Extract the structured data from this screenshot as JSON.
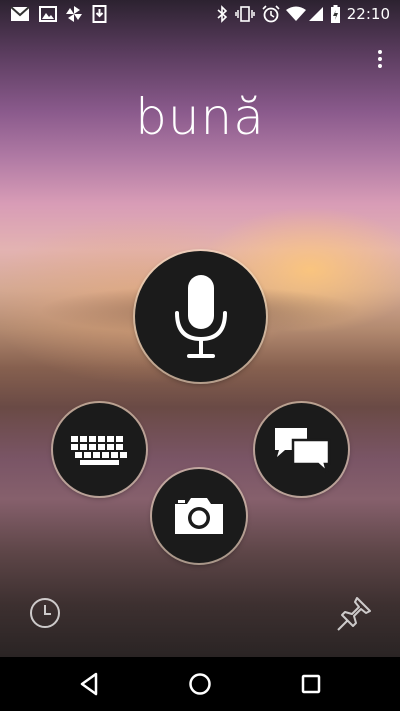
{
  "status_bar": {
    "time": "22:10",
    "left_icons": [
      "gmail-icon",
      "gallery-icon",
      "pinwheel-icon",
      "download-icon"
    ],
    "right_icons": [
      "bluetooth-icon",
      "vibrate-icon",
      "alarm-icon",
      "wifi-icon",
      "signal-icon",
      "battery-icon"
    ]
  },
  "app": {
    "greeting": "bună"
  },
  "actions": [
    {
      "name": "microphone",
      "icon": "microphone-icon"
    },
    {
      "name": "keyboard",
      "icon": "keyboard-icon"
    },
    {
      "name": "conversation",
      "icon": "chat-bubbles-icon"
    },
    {
      "name": "camera",
      "icon": "camera-icon"
    }
  ],
  "bottom": {
    "left_icon": "history-icon",
    "right_icon": "pin-icon"
  },
  "navigation": [
    "back",
    "home",
    "recents"
  ],
  "colors": {
    "button_fill": "#1b1b1b",
    "button_ring": "#ffebd2",
    "text": "#ffffff"
  }
}
